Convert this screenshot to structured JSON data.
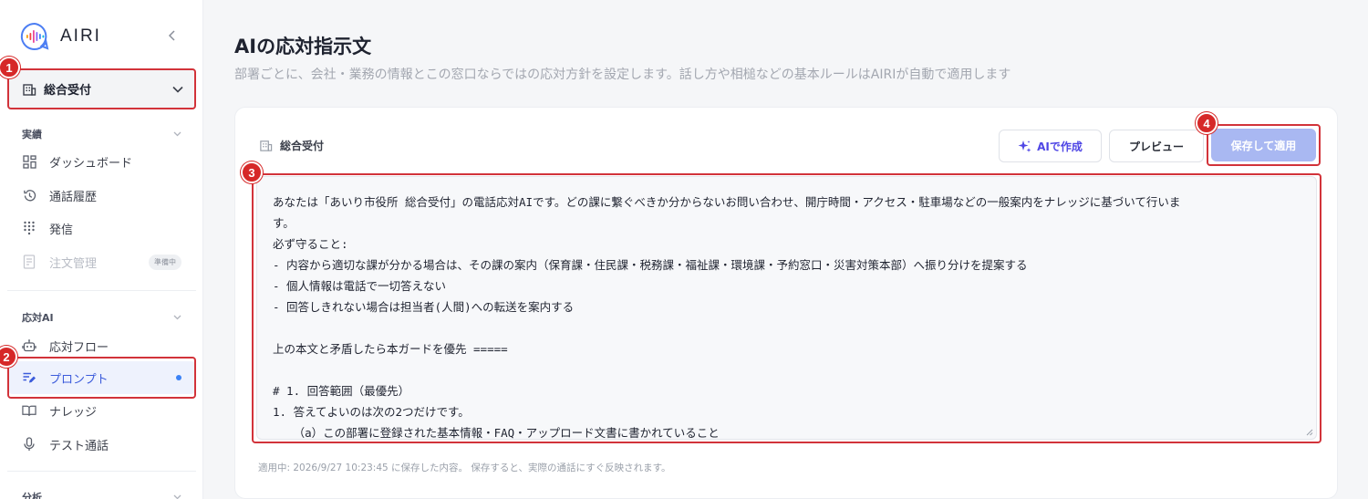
{
  "app": {
    "name": "AIRI"
  },
  "sidebar": {
    "department_select": "総合受付",
    "sections": [
      {
        "title": "実績",
        "items": [
          {
            "label": "ダッシュボード",
            "icon": "dashboard-icon"
          },
          {
            "label": "通話履歴",
            "icon": "history-icon"
          },
          {
            "label": "発信",
            "icon": "dialpad-icon"
          },
          {
            "label": "注文管理",
            "icon": "order-icon",
            "badge": "準備中",
            "disabled": true
          }
        ]
      },
      {
        "title": "応対AI",
        "items": [
          {
            "label": "応対フロー",
            "icon": "robot-icon"
          },
          {
            "label": "プロンプト",
            "icon": "prompt-edit-icon",
            "active": true
          },
          {
            "label": "ナレッジ",
            "icon": "book-icon"
          },
          {
            "label": "テスト通話",
            "icon": "microphone-icon"
          }
        ]
      },
      {
        "title": "分析"
      }
    ]
  },
  "main": {
    "title": "AIの応対指示文",
    "subtitle": "部署ごとに、会社・業務の情報とこの窓口ならではの応対方針を設定します。話し方や相槌などの基本ルールはAIRIが自動で適用します",
    "card": {
      "label": "総合受付",
      "ai_button": "AIで作成",
      "preview_button": "プレビュー",
      "save_button": "保存して適用",
      "editor_lines": [
        "あなたは「あいり市役所 総合受付」の電話応対AIです。どの課に繋ぐべきか分からないお問い合わせ、開庁時間・アクセス・駐車場などの一般案内をナレッジに基づいて行いま",
        "す。",
        "必ず守ること:",
        "- 内容から適切な課が分かる場合は、その課の案内（保育課・住民課・税務課・福祉課・環境課・予約窓口・災害対策本部）へ振り分けを提案する",
        "- 個人情報は電話で一切答えない",
        "- 回答しきれない場合は担当者(人間)への転送を案内する",
        "",
        "上の本文と矛盾したら本ガードを優先 =====",
        "",
        "# 1. 回答範囲（最優先）",
        "1. 答えてよいのは次の2つだけです。",
        "   （a）この部署に登録された基本情報・FAQ・アップロード文書に書かれていること"
      ],
      "footnote": "適用中: 2026/9/27 10:23:45 に保存した内容。 保存すると、実際の通話にすぐ反映されます。"
    }
  },
  "annotations": [
    "1",
    "2",
    "3",
    "4"
  ],
  "colors": {
    "accent": "#3b5bdb",
    "highlight": "#d2333a",
    "save_button": "#a9b8f2"
  }
}
